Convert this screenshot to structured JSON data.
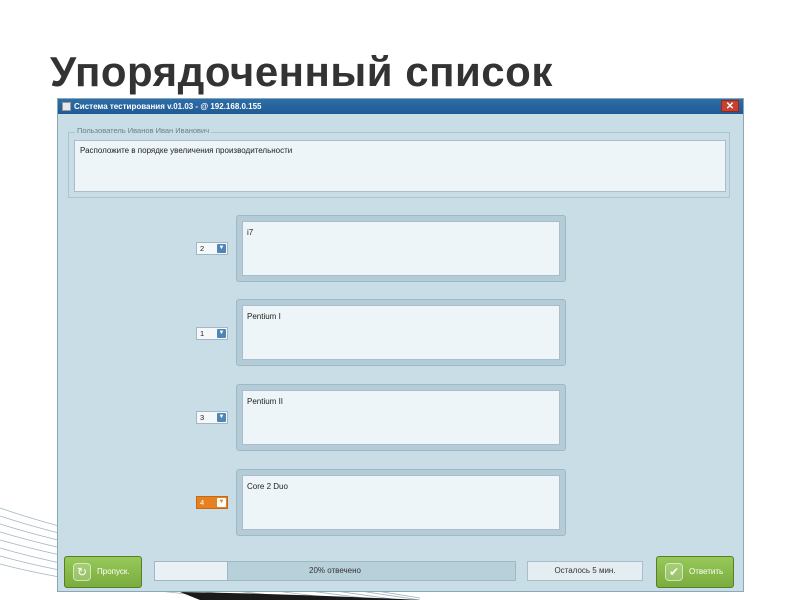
{
  "slide": {
    "title": "Упорядоченный список"
  },
  "window": {
    "title": "Система тестирования v.01.03 -  @ 192.168.0.155",
    "close_label": "✕"
  },
  "question": {
    "user_label": "Пользователь Иванов Иван Иванович",
    "prompt": "Расположите в порядке увеличения производительности"
  },
  "answers": [
    {
      "order": "2",
      "text": "i7"
    },
    {
      "order": "1",
      "text": "Pentium I"
    },
    {
      "order": "3",
      "text": "Pentium II"
    },
    {
      "order": "4",
      "text": "Core 2 Duo"
    }
  ],
  "footer": {
    "skip_label": "Пропуск.",
    "progress_text": "20% отвечено",
    "progress_fraction": 0.2,
    "time_left": "Осталось 5 мин.",
    "answer_label": "Ответить"
  },
  "colors": {
    "window_bg": "#c9dde6",
    "titlebar": "#1f5a94",
    "button_green": "#79ad3d",
    "active_select": "#e7801e"
  }
}
